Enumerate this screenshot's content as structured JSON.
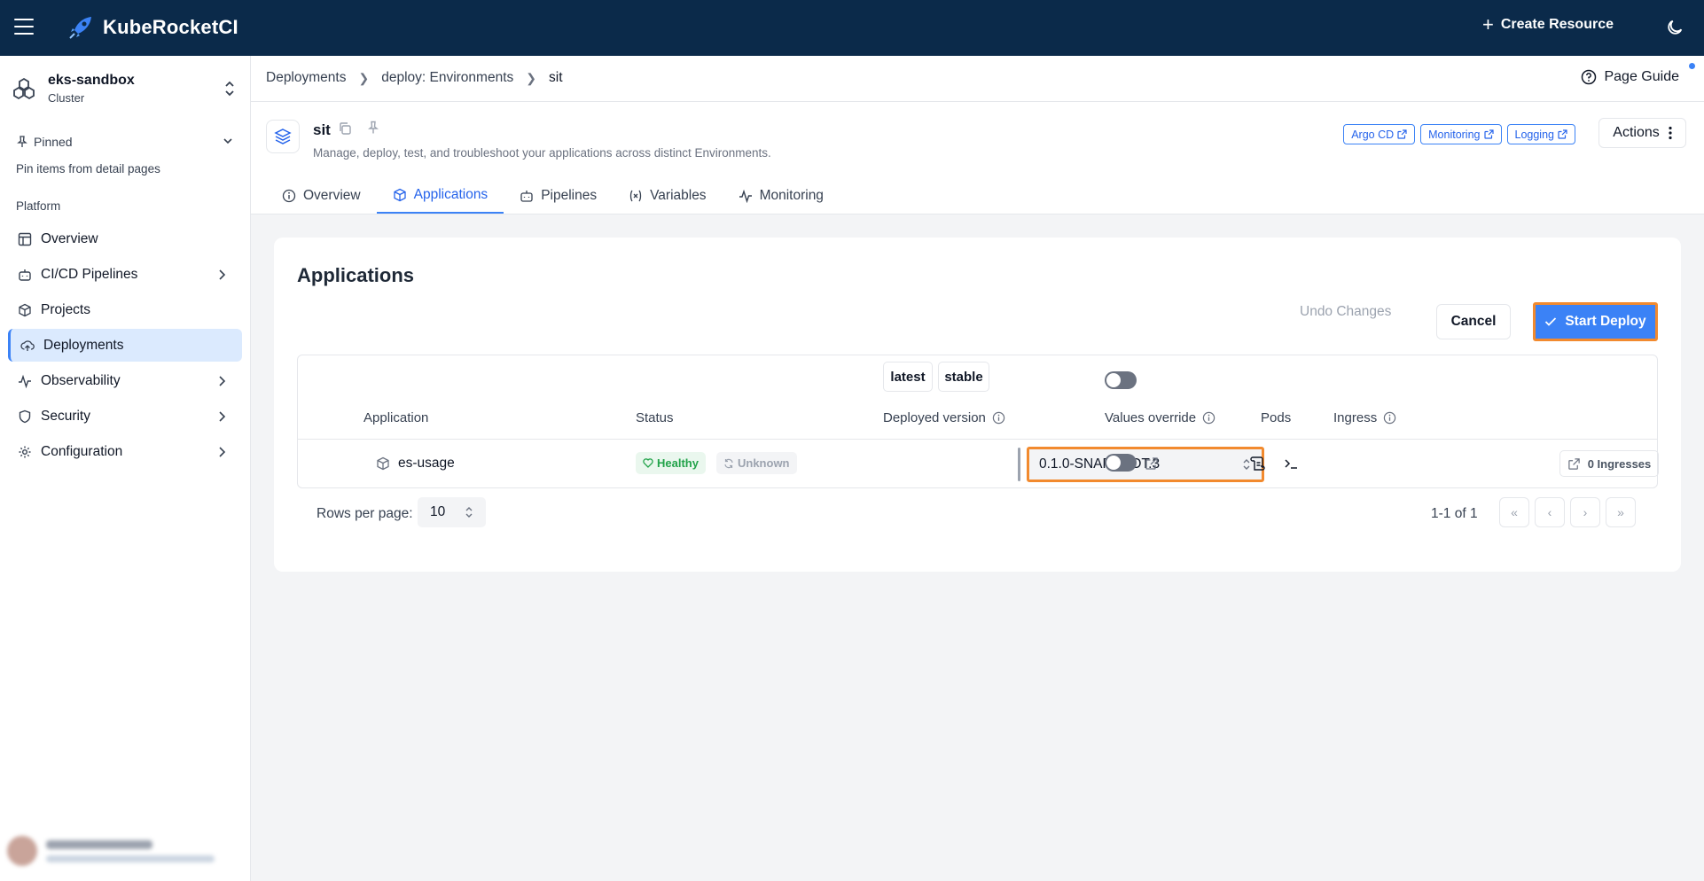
{
  "app": {
    "name": "KubeRocketCI"
  },
  "topbar": {
    "create_resource": "Create Resource"
  },
  "sidebar": {
    "cluster": {
      "name": "eks-sandbox",
      "type": "Cluster"
    },
    "pinned": {
      "label": "Pinned",
      "hint": "Pin items from detail pages"
    },
    "section": "Platform",
    "items": [
      {
        "label": "Overview",
        "icon": "layout-icon",
        "expandable": false,
        "active": false
      },
      {
        "label": "CI/CD Pipelines",
        "icon": "bot-icon",
        "expandable": true,
        "active": false
      },
      {
        "label": "Projects",
        "icon": "box-icon",
        "expandable": false,
        "active": false
      },
      {
        "label": "Deployments",
        "icon": "cloud-upload-icon",
        "expandable": false,
        "active": true
      },
      {
        "label": "Observability",
        "icon": "activity-icon",
        "expandable": true,
        "active": false
      },
      {
        "label": "Security",
        "icon": "shield-icon",
        "expandable": true,
        "active": false
      },
      {
        "label": "Configuration",
        "icon": "gear-icon",
        "expandable": true,
        "active": false
      }
    ]
  },
  "breadcrumb": {
    "items": [
      "Deployments",
      "deploy: Environments"
    ],
    "current": "sit"
  },
  "page_guide": "Page Guide",
  "header": {
    "title": "sit",
    "description": "Manage, deploy, test, and troubleshoot your applications across distinct Environments.",
    "links": [
      "Argo CD",
      "Monitoring",
      "Logging"
    ],
    "actions": "Actions"
  },
  "tabs": [
    {
      "label": "Overview",
      "icon": "info-icon",
      "active": false
    },
    {
      "label": "Applications",
      "icon": "box-icon",
      "active": true
    },
    {
      "label": "Pipelines",
      "icon": "bot-icon",
      "active": false
    },
    {
      "label": "Variables",
      "icon": "variable-icon",
      "active": false
    },
    {
      "label": "Monitoring",
      "icon": "activity-icon",
      "active": false
    }
  ],
  "card": {
    "title": "Applications",
    "undo": "Undo Changes",
    "cancel": "Cancel",
    "start_deploy": "Start Deploy"
  },
  "table": {
    "version_chips": [
      "latest",
      "stable"
    ],
    "columns": {
      "application": "Application",
      "status": "Status",
      "deployed_version": "Deployed version",
      "values_override": "Values override",
      "pods": "Pods",
      "ingress": "Ingress"
    },
    "rows": [
      {
        "application": "es-usage",
        "health": "Healthy",
        "sync": "Unknown",
        "version": "0.1.0-SNAPSHOT.3",
        "ingresses": "0 Ingresses"
      }
    ]
  },
  "pagination": {
    "rows_per_page_label": "Rows per page:",
    "rows_per_page": "10",
    "range": "1-1 of 1",
    "first": "«",
    "prev": "‹",
    "next": "›",
    "last": "»"
  }
}
